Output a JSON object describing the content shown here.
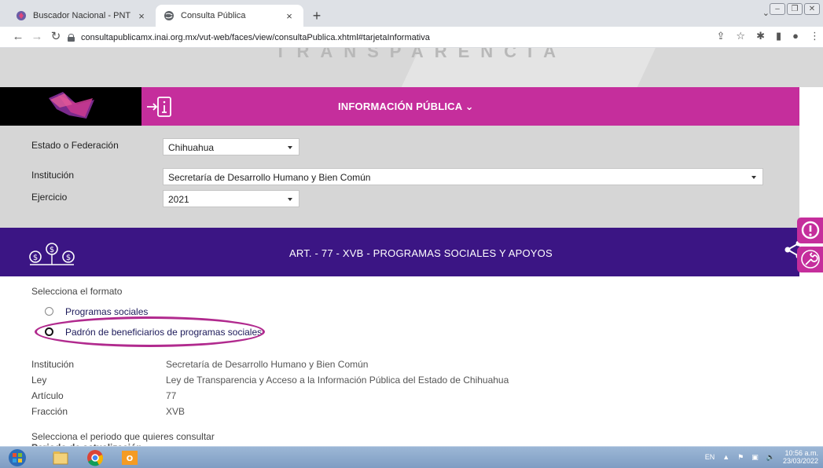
{
  "browser": {
    "tabs": [
      {
        "label": "Buscador Nacional - PNT",
        "close": "×"
      },
      {
        "label": "Consulta Pública",
        "close": "×"
      }
    ],
    "new_tab": "+",
    "url": "consultapublicamx.inai.org.mx/vut-web/faces/view/consultaPublica.xhtml#tarjetaInformativa"
  },
  "banner": {
    "title": "INFORMACIÓN PÚBLICA ⌄"
  },
  "filters": {
    "estado_label": "Estado o Federación",
    "estado_value": "Chihuahua",
    "institucion_label": "Institución",
    "institucion_value": "Secretaría de Desarrollo Humano y Bien Común",
    "ejercicio_label": "Ejercicio",
    "ejercicio_value": "2021"
  },
  "section": {
    "title": "ART. - 77 - XVB - PROGRAMAS SOCIALES Y APOYOS"
  },
  "formato": {
    "prompt": "Selecciona el formato",
    "options": [
      {
        "label": "Programas sociales",
        "checked": false
      },
      {
        "label": "Padrón de beneficiarios de programas sociales",
        "checked": true
      }
    ]
  },
  "details": [
    {
      "label": "Institución",
      "value": "Secretaría de Desarrollo Humano y Bien Común"
    },
    {
      "label": "Ley",
      "value": "Ley de Transparencia y Acceso a la Información Pública del Estado de Chihuahua"
    },
    {
      "label": "Artículo",
      "value": "77"
    },
    {
      "label": "Fracción",
      "value": "XVB"
    }
  ],
  "periodo": {
    "prompt": "Selecciona el periodo que quieres consultar",
    "partial_label": "Periodo de actualización"
  },
  "taskbar": {
    "lang": "EN",
    "time": "10:56 a.m.",
    "date": "23/03/2022"
  },
  "colors": {
    "magenta": "#c52e9c",
    "purple": "#3b1584",
    "gray_panel": "#d6d6d6"
  }
}
